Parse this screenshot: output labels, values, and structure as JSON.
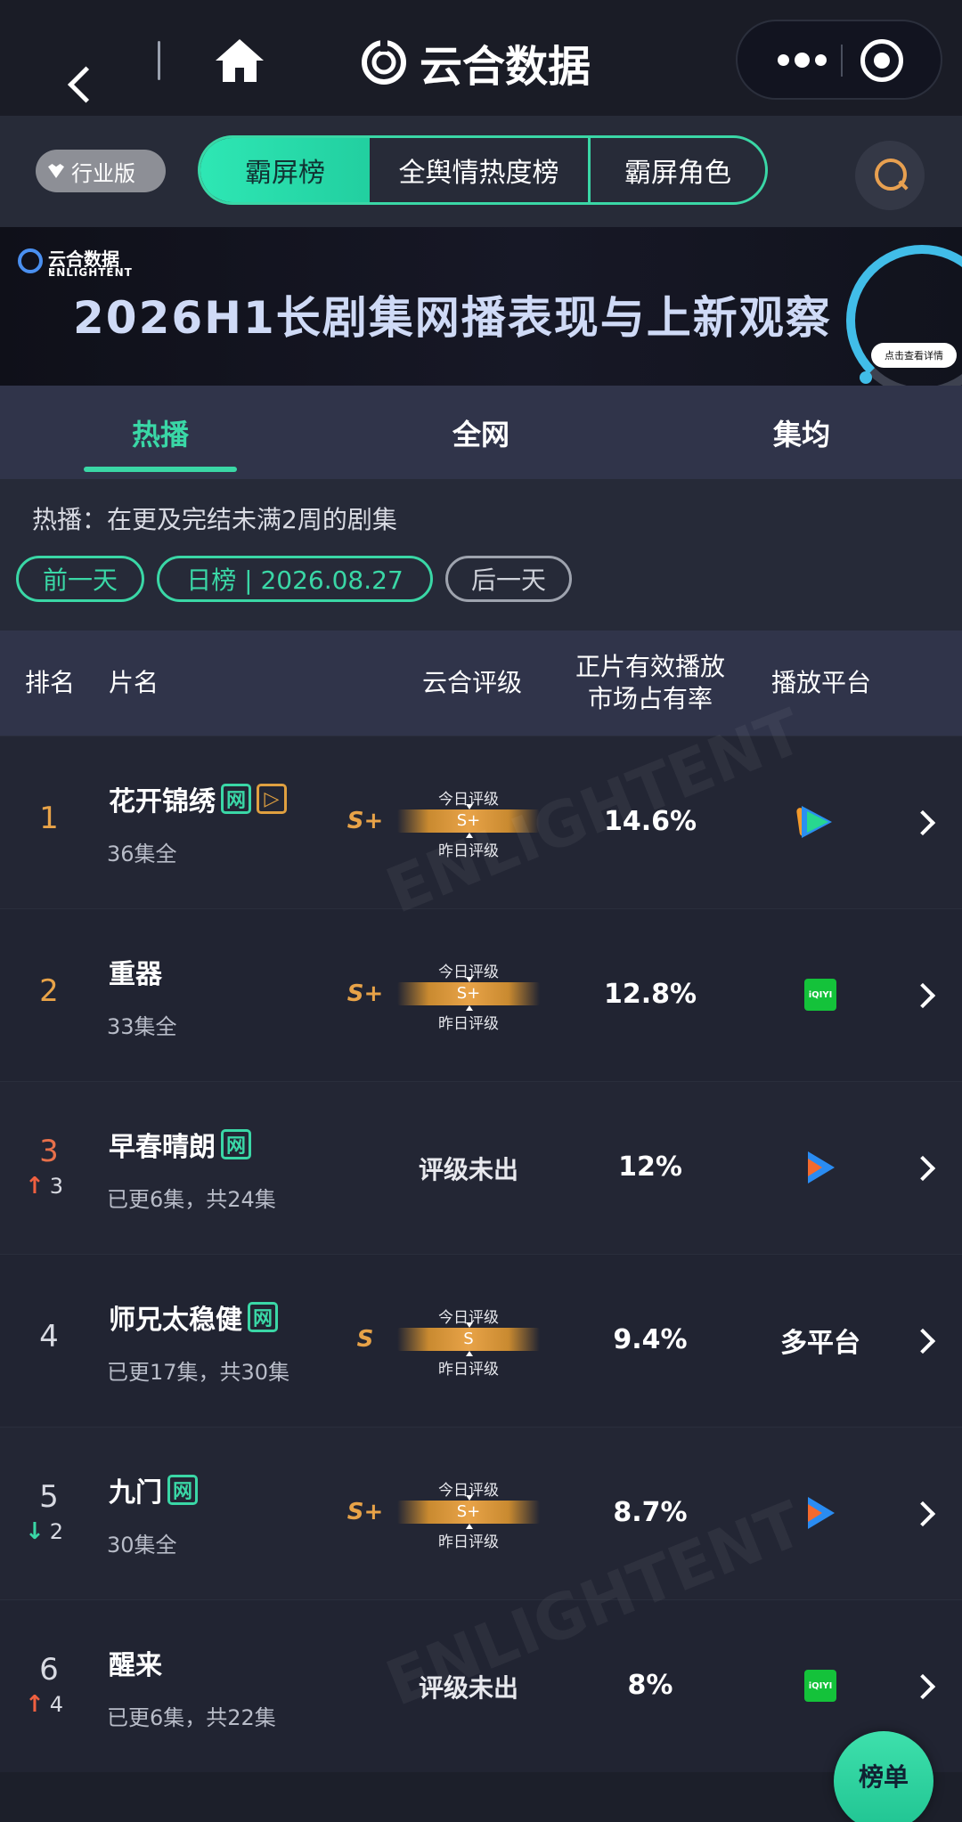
{
  "nav": {
    "app_title": "云合数据"
  },
  "tabs": {
    "edition": "行业版",
    "items": [
      "霸屏榜",
      "全舆情热度榜",
      "霸屏角色"
    ]
  },
  "banner": {
    "logo_cn": "云合数据",
    "logo_en": "ENLIGHTENT",
    "title": "2026H1长剧集网播表现与上新观察",
    "cta": "点击查看详情"
  },
  "subtabs": [
    "热播",
    "全网",
    "集均"
  ],
  "filter": {
    "description": "热播：在更及完结未满2周的剧集",
    "prev": "前一天",
    "current": "日榜 | 2026.08.27",
    "next": "后一天"
  },
  "table": {
    "headers": {
      "rank": "排名",
      "title": "片名",
      "grade": "云合评级",
      "share_line1": "正片有效播放",
      "share_line2": "市场占有率",
      "platform": "播放平台"
    },
    "grade_today_label": "今日评级",
    "grade_yesterday_label": "昨日评级",
    "rows": [
      {
        "rank": "1",
        "rank_color": "#e8a348",
        "change_dir": "",
        "change": "",
        "title": "花开锦绣",
        "tags": [
          "网",
          "▷"
        ],
        "episodes": "36集全",
        "grade": "S+",
        "grade_bar": "S+",
        "grade_status": "",
        "share": "14.6%",
        "platform": "tencent",
        "platform_label": ""
      },
      {
        "rank": "2",
        "rank_color": "#e8a348",
        "change_dir": "",
        "change": "",
        "title": "重器",
        "tags": [],
        "episodes": "33集全",
        "grade": "S+",
        "grade_bar": "S+",
        "grade_status": "",
        "share": "12.8%",
        "platform": "iqiyi",
        "platform_label": "iQIYI"
      },
      {
        "rank": "3",
        "rank_color": "#e8704a",
        "change_dir": "up",
        "change": "3",
        "title": "早春晴朗",
        "tags": [
          "网"
        ],
        "episodes": "已更6集，共24集",
        "grade": "",
        "grade_bar": "",
        "grade_status": "评级未出",
        "share": "12%",
        "platform": "youku",
        "platform_label": ""
      },
      {
        "rank": "4",
        "rank_color": "#d8dae2",
        "change_dir": "",
        "change": "",
        "title": "师兄太稳健",
        "tags": [
          "网"
        ],
        "episodes": "已更17集，共30集",
        "grade": "S",
        "grade_bar": "S",
        "grade_status": "",
        "share": "9.4%",
        "platform": "multi",
        "platform_label": "多平台"
      },
      {
        "rank": "5",
        "rank_color": "#d8dae2",
        "change_dir": "down",
        "change": "2",
        "title": "九门",
        "tags": [
          "网"
        ],
        "episodes": "30集全",
        "grade": "S+",
        "grade_bar": "S+",
        "grade_status": "",
        "share": "8.7%",
        "platform": "youku",
        "platform_label": ""
      },
      {
        "rank": "6",
        "rank_color": "#d8dae2",
        "change_dir": "up",
        "change": "4",
        "title": "醒来",
        "tags": [],
        "episodes": "已更6集，共22集",
        "grade": "",
        "grade_bar": "",
        "grade_status": "评级未出",
        "share": "8%",
        "platform": "iqiyi",
        "platform_label": "iQIYI"
      }
    ]
  },
  "fab": {
    "label": "榜单"
  }
}
